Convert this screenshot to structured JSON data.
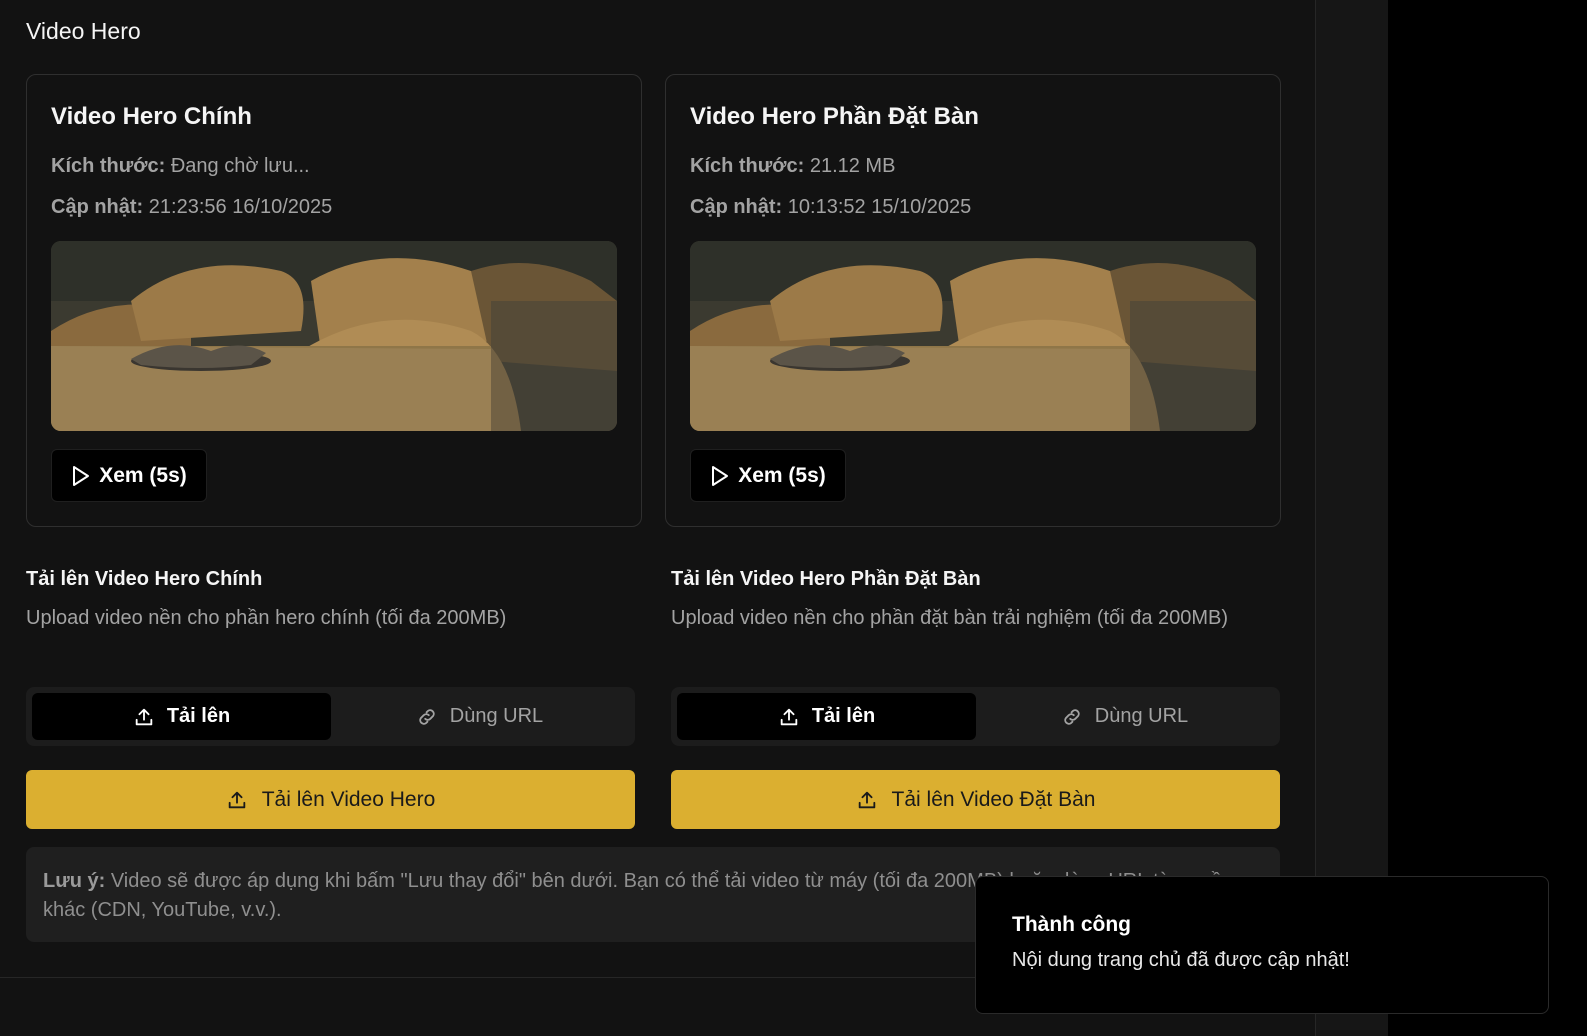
{
  "section": {
    "title": "Video Hero"
  },
  "cards": [
    {
      "title": "Video Hero Chính",
      "size_label": "Kích thước:",
      "size_value": "Đang chờ lưu...",
      "updated_label": "Cập nhật:",
      "updated_value": "21:23:56 16/10/2025",
      "play_label": "Xem (5s)"
    },
    {
      "title": "Video Hero Phần Đặt Bàn",
      "size_label": "Kích thước:",
      "size_value": "21.12 MB",
      "updated_label": "Cập nhật:",
      "updated_value": "10:13:52 15/10/2025",
      "play_label": "Xem (5s)"
    }
  ],
  "uploads": [
    {
      "heading": "Tải lên Video Hero Chính",
      "description": "Upload video nền cho phần hero chính (tối đa 200MB)",
      "tab_upload": "Tải lên",
      "tab_url": "Dùng URL",
      "button": "Tải lên Video Hero"
    },
    {
      "heading": "Tải lên Video Hero Phần Đặt Bàn",
      "description": "Upload video nền cho phần đặt bàn trải nghiệm (tối đa 200MB)",
      "tab_upload": "Tải lên",
      "tab_url": "Dùng URL",
      "button": "Tải lên Video Đặt Bàn"
    }
  ],
  "note": {
    "label": "Lưu ý:",
    "text": "Video sẽ được áp dụng khi bấm \"Lưu thay đổi\" bên dưới. Bạn có thể tải video từ máy (tối đa 200MB) hoặc dùng URL từ nguồn khác (CDN, YouTube, v.v.)."
  },
  "toast": {
    "title": "Thành công",
    "message": "Nội dung trang chủ đã được cập nhật!"
  },
  "colors": {
    "accent": "#dbaf30",
    "background": "#121212"
  },
  "icons": [
    "play-icon",
    "upload-icon",
    "link-icon"
  ]
}
